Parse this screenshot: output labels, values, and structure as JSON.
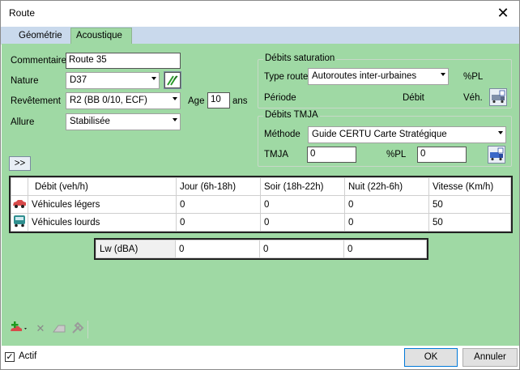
{
  "window": {
    "title": "Route",
    "close_glyph": "✕"
  },
  "tabs": [
    {
      "label": "Géométrie"
    },
    {
      "label": "Acoustique"
    }
  ],
  "form": {
    "commentaire_label": "Commentaire",
    "commentaire_value": "Route 35",
    "nature_label": "Nature",
    "nature_value": "D37",
    "revetement_label": "Revêtement",
    "revetement_value": "R2 (BB 0/10, ECF)",
    "age_label": "Age",
    "age_value": "10",
    "age_unit": "ans",
    "allure_label": "Allure",
    "allure_value": "Stabilisée",
    "expand_label": ">>"
  },
  "saturation": {
    "title": "Débits saturation",
    "type_route_label": "Type route",
    "type_route_value": "Autoroutes inter-urbaines",
    "pct_pl_label": "%PL",
    "periode_label": "Période",
    "debit_label": "Débit",
    "veh_label": "Véh."
  },
  "tmja": {
    "title": "Débits TMJA",
    "methode_label": "Méthode",
    "methode_value": "Guide CERTU Carte Stratégique",
    "tmja_label": "TMJA",
    "tmja_value": "0",
    "pct_pl_label": "%PL",
    "pct_pl_value": "0"
  },
  "grid": {
    "headers": [
      "Débit (veh/h)",
      "Jour (6h-18h)",
      "Soir (18h-22h)",
      "Nuit (22h-6h)",
      "Vitesse (Km/h)"
    ],
    "rows": [
      {
        "label": "Véhicules légers",
        "jour": "0",
        "soir": "0",
        "nuit": "0",
        "vitesse": "50"
      },
      {
        "label": "Véhicules lourds",
        "jour": "0",
        "soir": "0",
        "nuit": "0",
        "vitesse": "50"
      }
    ]
  },
  "lw": {
    "label": "Lw (dBA)",
    "values": [
      "0",
      "0",
      "0"
    ]
  },
  "footer": {
    "actif_label": "Actif",
    "ok_label": "OK",
    "cancel_label": "Annuler"
  }
}
